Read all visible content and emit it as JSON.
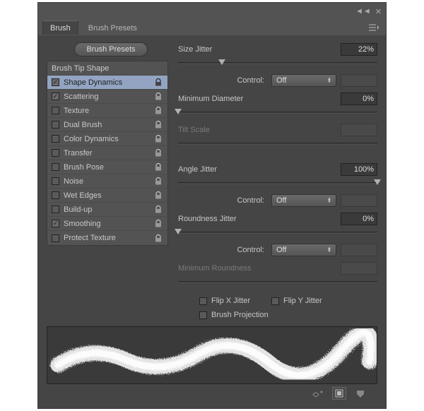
{
  "topbar": {
    "collapse": "◄◄",
    "close": "✕"
  },
  "tabs": {
    "active": "Brush",
    "items": [
      "Brush",
      "Brush Presets"
    ]
  },
  "presetsButton": "Brush Presets",
  "options": {
    "header": "Brush Tip Shape",
    "items": [
      {
        "label": "Shape Dynamics",
        "checked": true,
        "locked": true,
        "selected": true
      },
      {
        "label": "Scattering",
        "checked": true,
        "locked": true,
        "selected": false
      },
      {
        "label": "Texture",
        "checked": false,
        "locked": true,
        "selected": false
      },
      {
        "label": "Dual Brush",
        "checked": false,
        "locked": true,
        "selected": false
      },
      {
        "label": "Color Dynamics",
        "checked": false,
        "locked": true,
        "selected": false
      },
      {
        "label": "Transfer",
        "checked": false,
        "locked": true,
        "selected": false
      },
      {
        "label": "Brush Pose",
        "checked": false,
        "locked": true,
        "selected": false
      },
      {
        "label": "Noise",
        "checked": false,
        "locked": true,
        "selected": false
      },
      {
        "label": "Wet Edges",
        "checked": false,
        "locked": true,
        "selected": false
      },
      {
        "label": "Build-up",
        "checked": false,
        "locked": true,
        "selected": false
      },
      {
        "label": "Smoothing",
        "checked": true,
        "locked": true,
        "selected": false
      },
      {
        "label": "Protect Texture",
        "checked": false,
        "locked": true,
        "selected": false
      }
    ]
  },
  "controls": {
    "sizeJitter": {
      "label": "Size Jitter",
      "value": "22%",
      "sliderPct": 22
    },
    "sizeControl": {
      "label": "Control:",
      "value": "Off"
    },
    "minDiameter": {
      "label": "Minimum Diameter",
      "value": "0%",
      "sliderPct": 0
    },
    "tiltScale": {
      "label": "Tilt Scale",
      "value": "",
      "enabled": false
    },
    "angleJitter": {
      "label": "Angle Jitter",
      "value": "100%",
      "sliderPct": 100
    },
    "angleControl": {
      "label": "Control:",
      "value": "Off"
    },
    "roundnessJitter": {
      "label": "Roundness Jitter",
      "value": "0%",
      "sliderPct": 0
    },
    "roundnessControl": {
      "label": "Control:",
      "value": "Off"
    },
    "minRoundness": {
      "label": "Minimum Roundness",
      "value": "",
      "enabled": false
    },
    "flipX": {
      "label": "Flip X Jitter",
      "checked": false
    },
    "flipY": {
      "label": "Flip Y Jitter",
      "checked": false
    },
    "brushProjection": {
      "label": "Brush Projection",
      "checked": false
    }
  },
  "footerIcons": [
    "toggle-live-preview-icon",
    "new-preset-icon",
    "reset-icon"
  ]
}
